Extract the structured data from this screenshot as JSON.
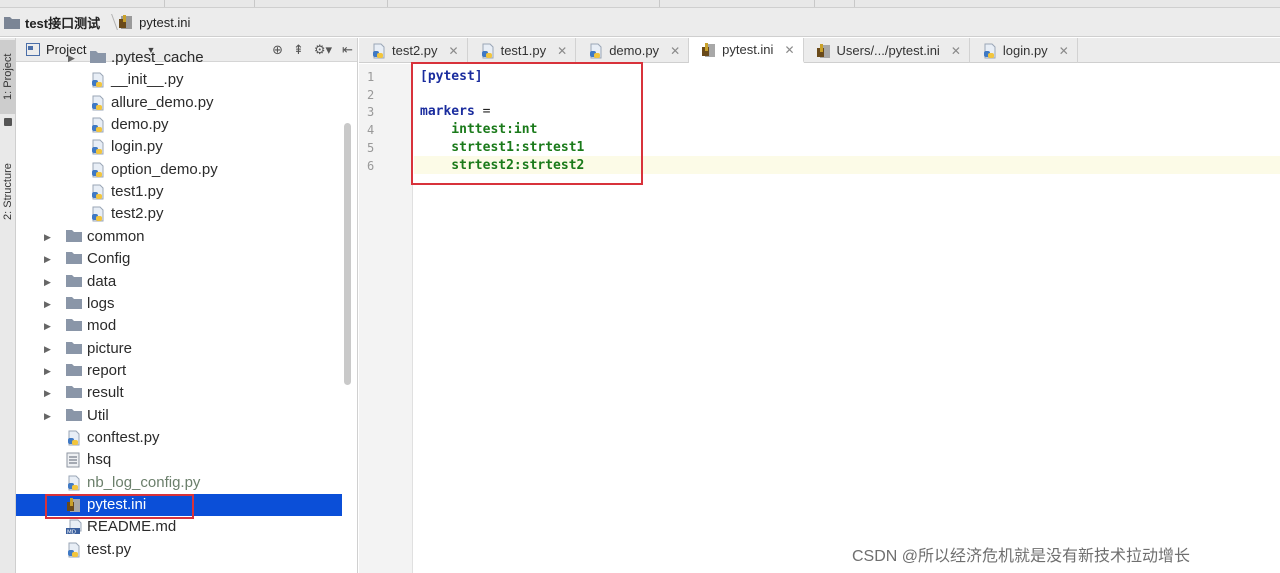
{
  "breadcrumb": {
    "project": "test接口测试",
    "file": "pytest.ini"
  },
  "side_tabs": {
    "project": "1: Project",
    "structure": "2: Structure"
  },
  "project_panel": {
    "title": "Project",
    "tree": [
      {
        "label": ".pytest_cache",
        "type": "folder",
        "depth": 2
      },
      {
        "label": "__init__.py",
        "type": "py",
        "depth": 2
      },
      {
        "label": "allure_demo.py",
        "type": "py",
        "depth": 2
      },
      {
        "label": "demo.py",
        "type": "py",
        "depth": 2
      },
      {
        "label": "login.py",
        "type": "py",
        "depth": 2
      },
      {
        "label": "option_demo.py",
        "type": "py",
        "depth": 2
      },
      {
        "label": "test1.py",
        "type": "py",
        "depth": 2
      },
      {
        "label": "test2.py",
        "type": "py",
        "depth": 2
      },
      {
        "label": "common",
        "type": "folder",
        "depth": 1
      },
      {
        "label": "Config",
        "type": "folder",
        "depth": 1
      },
      {
        "label": "data",
        "type": "folder",
        "depth": 1
      },
      {
        "label": "logs",
        "type": "folder",
        "depth": 1
      },
      {
        "label": "mod",
        "type": "folder",
        "depth": 1
      },
      {
        "label": "picture",
        "type": "folder",
        "depth": 1
      },
      {
        "label": "report",
        "type": "folder",
        "depth": 1
      },
      {
        "label": "result",
        "type": "folder",
        "depth": 1
      },
      {
        "label": "Util",
        "type": "folder",
        "depth": 1
      },
      {
        "label": "conftest.py",
        "type": "py",
        "depth": 1
      },
      {
        "label": "hsq",
        "type": "text",
        "depth": 1
      },
      {
        "label": "nb_log_config.py",
        "type": "py",
        "depth": 1
      },
      {
        "label": "pytest.ini",
        "type": "ini",
        "depth": 1,
        "selected": true
      },
      {
        "label": "README.md",
        "type": "md",
        "depth": 1
      },
      {
        "label": "test.py",
        "type": "py",
        "depth": 1
      }
    ]
  },
  "tabs": [
    {
      "label": "test2.py",
      "type": "py"
    },
    {
      "label": "test1.py",
      "type": "py"
    },
    {
      "label": "demo.py",
      "type": "py"
    },
    {
      "label": "pytest.ini",
      "type": "ini",
      "active": true
    },
    {
      "label": "Users/.../pytest.ini",
      "type": "ini"
    },
    {
      "label": "login.py",
      "type": "py"
    }
  ],
  "editor": {
    "lines": [
      {
        "n": "1",
        "section": "[pytest]"
      },
      {
        "n": "2"
      },
      {
        "n": "3",
        "key": "markers",
        "eq": " ="
      },
      {
        "n": "4",
        "value": "    inttest:int"
      },
      {
        "n": "5",
        "value": "    strtest1:strtest1"
      },
      {
        "n": "6",
        "value": "    strtest2:strtest2"
      }
    ]
  },
  "watermark": "CSDN @所以经济危机就是没有新技术拉动增长"
}
